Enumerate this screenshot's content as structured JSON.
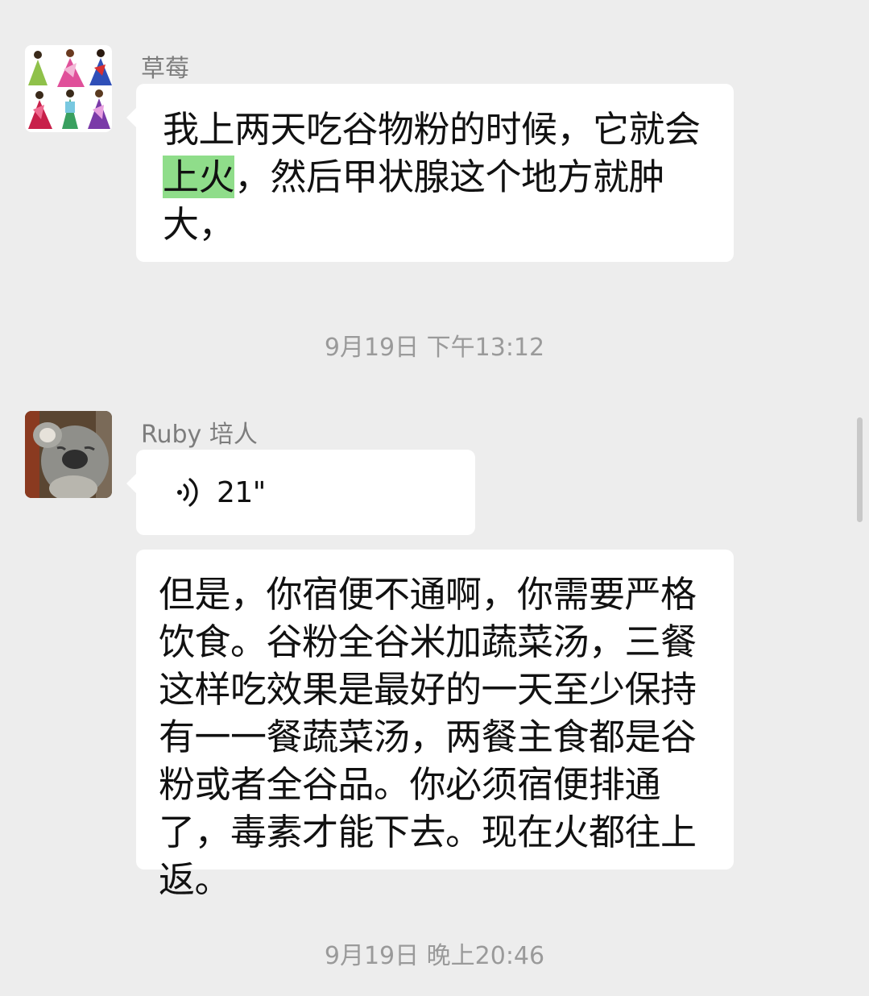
{
  "messages": [
    {
      "sender": "草莓",
      "avatar_icon": "dancing-figures-avatar",
      "text_before": "我上两天吃谷物粉的时候，它就会",
      "highlight": "上火",
      "text_after": "，然后甲状腺这个地方就肿大，"
    },
    {
      "timestamp": "9月19日 下午13:12"
    },
    {
      "sender": "Ruby 培人",
      "avatar_icon": "koala-avatar",
      "voice_icon": "voice-wave-icon",
      "voice_duration": "21\""
    },
    {
      "text": "但是，你宿便不通啊，你需要严格饮食。谷粉全谷米加蔬菜汤，三餐这样吃效果是最好的一天至少保持有一一餐蔬菜汤，两餐主食都是谷粉或者全谷品。你必须宿便排通了，毒素才能下去。现在火都往上返。"
    },
    {
      "timestamp": "9月19日 晚上20:46"
    }
  ],
  "colors": {
    "background": "#ededed",
    "bubble": "#ffffff",
    "highlight": "#8fdd8a",
    "name": "#7d7d7d",
    "timestamp": "#9a9a9a"
  }
}
